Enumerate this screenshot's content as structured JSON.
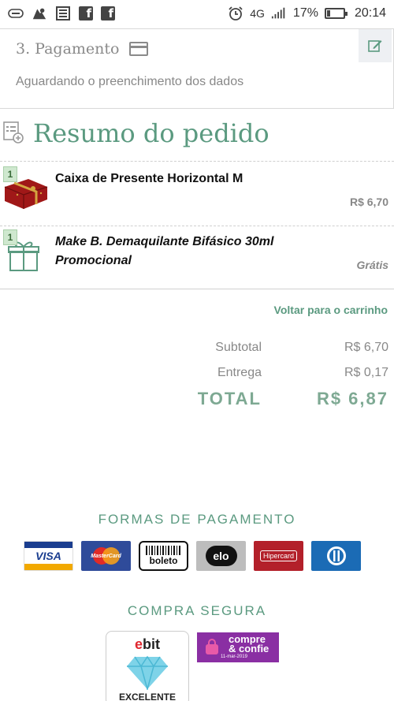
{
  "status_bar": {
    "signal": "4G",
    "battery": "17%",
    "time": "20:14"
  },
  "payment": {
    "title": "3. Pagamento",
    "subtitle": "Aguardando o preenchimento dos dados"
  },
  "summary": {
    "title": "Resumo do pedido",
    "items": [
      {
        "qty": "1",
        "name": "Caixa de Presente Horizontal M",
        "price": "R$ 6,70"
      },
      {
        "qty": "1",
        "name_line1": "Make B. Demaquilante Bifásico 30ml",
        "name_line2": "Promocional",
        "price": "Grátis"
      }
    ],
    "back_link": "Voltar para o carrinho",
    "subtotal_label": "Subtotal",
    "subtotal_value": "R$ 6,70",
    "delivery_label": "Entrega",
    "delivery_value": "R$ 0,17",
    "total_label": "TOTAL",
    "total_value": "R$ 6,87"
  },
  "payment_methods": {
    "title": "FORMAS DE PAGAMENTO",
    "logos": [
      "VISA",
      "MasterCard",
      "boleto",
      "elo",
      "Hipercard",
      "Diners"
    ]
  },
  "secure": {
    "title": "COMPRA SEGURA",
    "ebit_e": "e",
    "ebit_rest": "bit",
    "ebit_label": "EXCELENTE",
    "compre_line1": "compre",
    "compre_line2": "& confie",
    "compre_date": "11-mar-2019"
  },
  "colors": {
    "accent": "#5b9a80",
    "muted": "#888888"
  }
}
